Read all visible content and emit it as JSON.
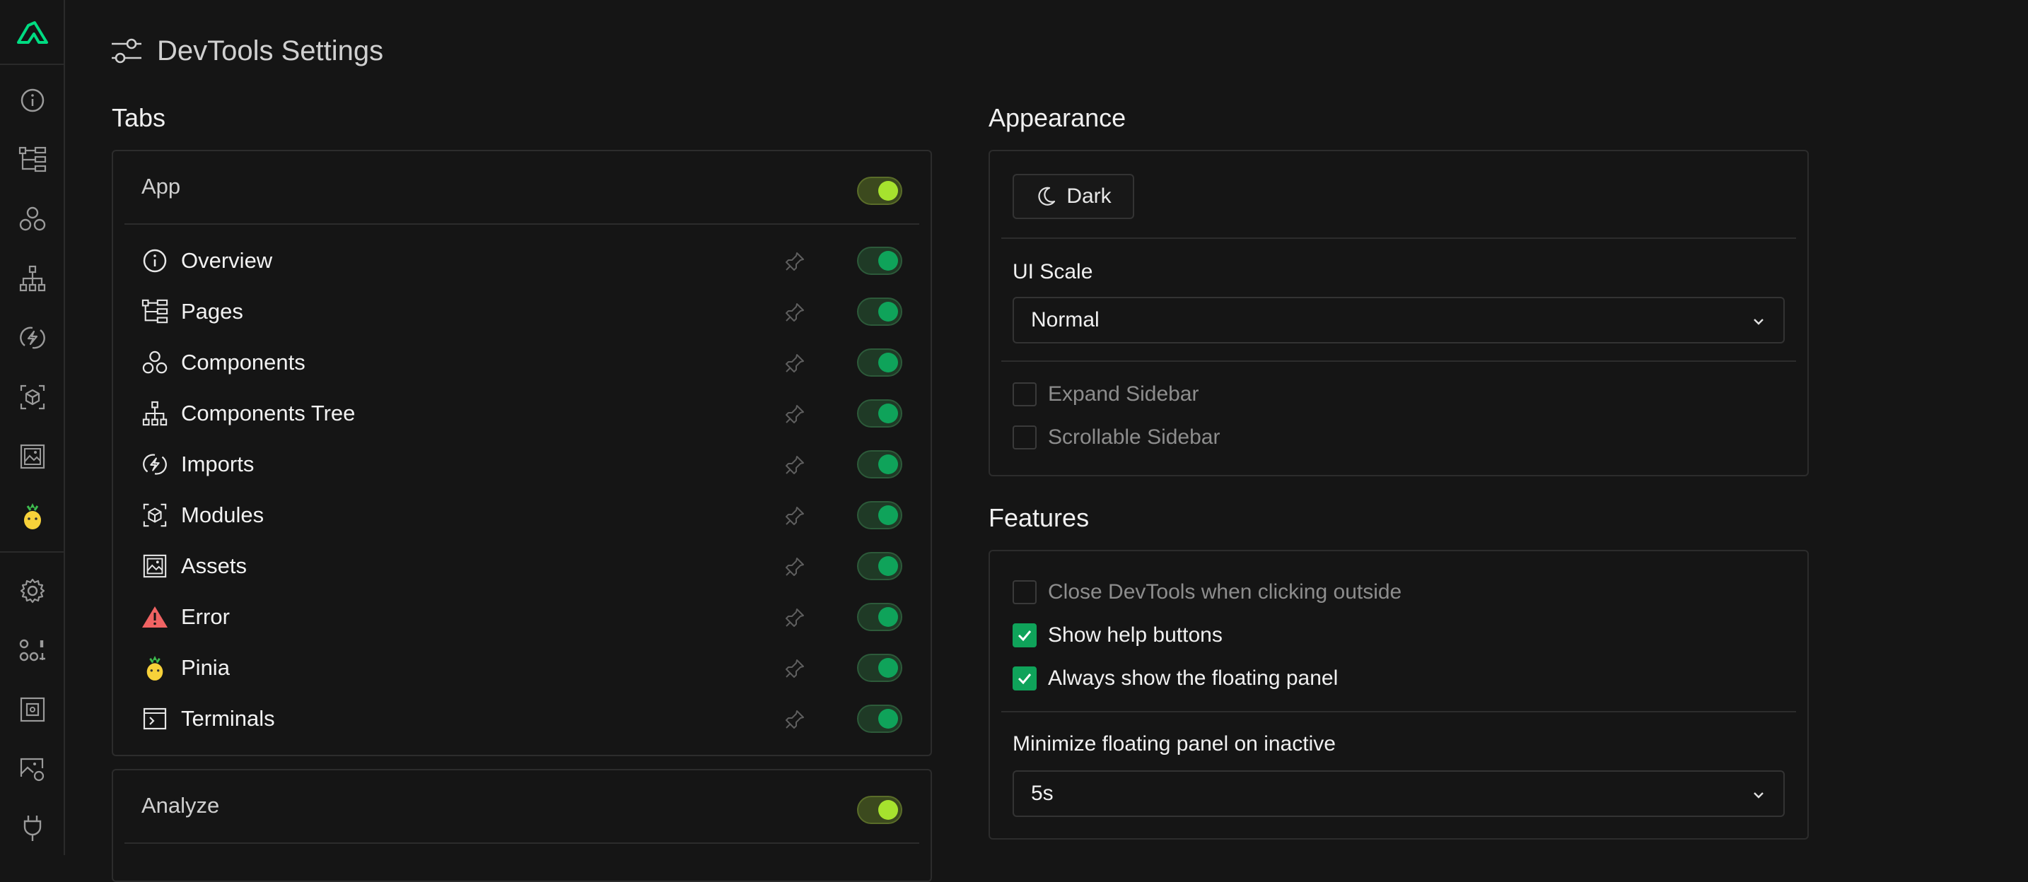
{
  "header": {
    "title": "DevTools Settings"
  },
  "sections": {
    "tabs": "Tabs",
    "appearance": "Appearance",
    "features": "Features"
  },
  "app_group": {
    "title": "App",
    "enabled": true,
    "items": [
      {
        "label": "Overview",
        "icon": "info-icon",
        "enabled": true
      },
      {
        "label": "Pages",
        "icon": "pages-tree-icon",
        "enabled": true
      },
      {
        "label": "Components",
        "icon": "components-icon",
        "enabled": true
      },
      {
        "label": "Components Tree",
        "icon": "hierarchy-icon",
        "enabled": true
      },
      {
        "label": "Imports",
        "icon": "imports-icon",
        "enabled": true
      },
      {
        "label": "Modules",
        "icon": "modules-icon",
        "enabled": true
      },
      {
        "label": "Assets",
        "icon": "assets-image-icon",
        "enabled": true
      },
      {
        "label": "Error",
        "icon": "warning-icon",
        "enabled": true
      },
      {
        "label": "Pinia",
        "icon": "pineapple-icon",
        "enabled": true
      },
      {
        "label": "Terminals",
        "icon": "terminal-icon",
        "enabled": true
      }
    ]
  },
  "analyze_group": {
    "title": "Analyze",
    "enabled": true
  },
  "appearance": {
    "theme_label": "Dark",
    "ui_scale_label": "UI Scale",
    "ui_scale_value": "Normal",
    "expand_sidebar": {
      "label": "Expand Sidebar",
      "checked": false
    },
    "scrollable_sidebar": {
      "label": "Scrollable Sidebar",
      "checked": false
    }
  },
  "features": {
    "close_outside": {
      "label": "Close DevTools when clicking outside",
      "checked": false
    },
    "help_buttons": {
      "label": "Show help buttons",
      "checked": true
    },
    "floating_panel": {
      "label": "Always show the floating panel",
      "checked": true
    },
    "minimize_label": "Minimize floating panel on inactive",
    "minimize_value": "5s"
  },
  "colors": {
    "accent_green": "#0fa35a",
    "switch_lime": "#a6e22e",
    "nuxt_green": "#00dc82",
    "background": "#151515"
  }
}
